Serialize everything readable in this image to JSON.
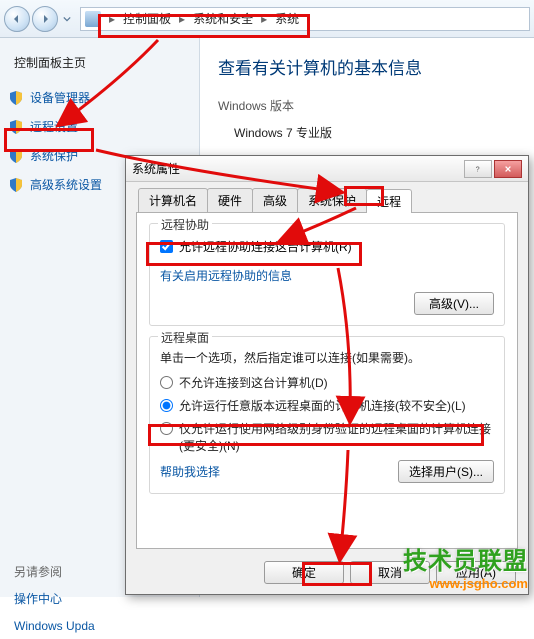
{
  "breadcrumb": {
    "item0": "控制面板",
    "item1": "系统和安全",
    "item2": "系统"
  },
  "sidebar": {
    "home": "控制面板主页",
    "items": [
      {
        "label": "设备管理器"
      },
      {
        "label": "远程设置"
      },
      {
        "label": "系统保护"
      },
      {
        "label": "高级系统设置"
      }
    ],
    "see_also_heading": "另请参阅",
    "see_also_items": [
      {
        "label": "操作中心"
      },
      {
        "label": "Windows Upda"
      }
    ]
  },
  "content": {
    "heading": "查看有关计算机的基本信息",
    "section_label": "Windows 版本",
    "edition": "Windows 7 专业版"
  },
  "dialog": {
    "title": "系统属性",
    "tabs": [
      {
        "label": "计算机名"
      },
      {
        "label": "硬件"
      },
      {
        "label": "高级"
      },
      {
        "label": "系统保护"
      },
      {
        "label": "远程"
      }
    ],
    "active_tab": 4,
    "assist": {
      "group_title": "远程协助",
      "checkbox_label": "允许远程协助连接这台计算机(R)",
      "checkbox_checked": true,
      "info_link": "有关启用远程协助的信息",
      "advanced_btn": "高级(V)..."
    },
    "rdp": {
      "group_title": "远程桌面",
      "desc": "单击一个选项，然后指定谁可以连接(如果需要)。",
      "options": [
        {
          "label": "不允许连接到这台计算机(D)"
        },
        {
          "label": "允许运行任意版本远程桌面的计算机连接(较不安全)(L)"
        },
        {
          "label": "仅允许运行使用网络级别身份验证的远程桌面的计算机连接(更安全)(N)"
        }
      ],
      "selected": 1,
      "help_link": "帮助我选择",
      "select_users_btn": "选择用户(S)..."
    },
    "buttons": {
      "ok": "确定",
      "cancel": "取消",
      "apply": "应用(A)"
    }
  },
  "watermark": {
    "brand": "技术员联盟",
    "url": "www.jsgho.com"
  }
}
